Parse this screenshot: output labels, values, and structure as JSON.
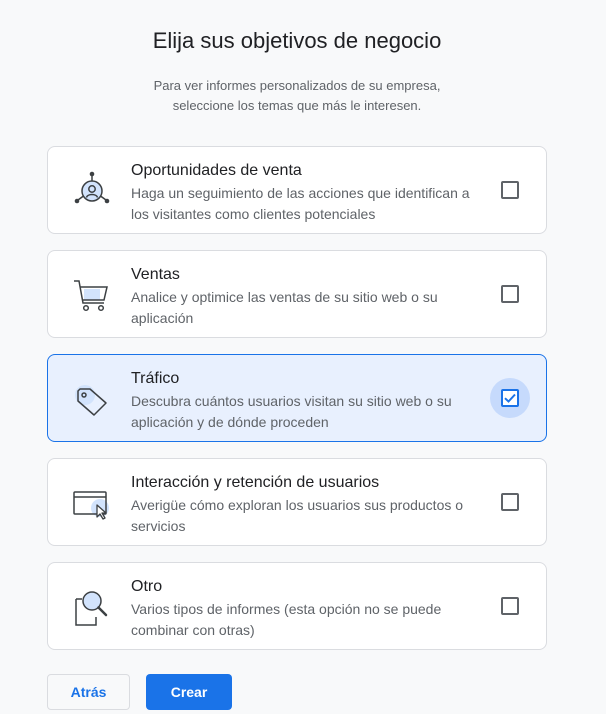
{
  "header": {
    "title": "Elija sus objetivos de negocio",
    "subtitle_line1": "Para ver informes personalizados de su empresa,",
    "subtitle_line2": "seleccione los temas que más le interesen."
  },
  "options": [
    {
      "title": "Oportunidades de venta",
      "description": "Haga un seguimiento de las acciones que identifican a los visitantes como clientes potenciales",
      "icon": "lead-network-icon",
      "checked": false
    },
    {
      "title": "Ventas",
      "description": "Analice y optimice las ventas de su sitio web o su aplicación",
      "icon": "shopping-cart-icon",
      "checked": false
    },
    {
      "title": "Tráfico",
      "description": "Descubra cuántos usuarios visitan su sitio web o su aplicación y de dónde proceden",
      "icon": "tag-icon",
      "checked": true
    },
    {
      "title": "Interacción y retención de usuarios",
      "description": "Averigüe cómo exploran los usuarios sus productos o servicios",
      "icon": "browser-cursor-icon",
      "checked": false
    },
    {
      "title": "Otro",
      "description": "Varios tipos de informes (esta opción no se puede combinar con otras)",
      "icon": "magnifier-report-icon",
      "checked": false
    }
  ],
  "footer": {
    "back_label": "Atrás",
    "create_label": "Crear"
  },
  "colors": {
    "accent": "#1a73e8",
    "selected_bg": "#e8f0fe",
    "icon_highlight": "#d2e3fc"
  }
}
